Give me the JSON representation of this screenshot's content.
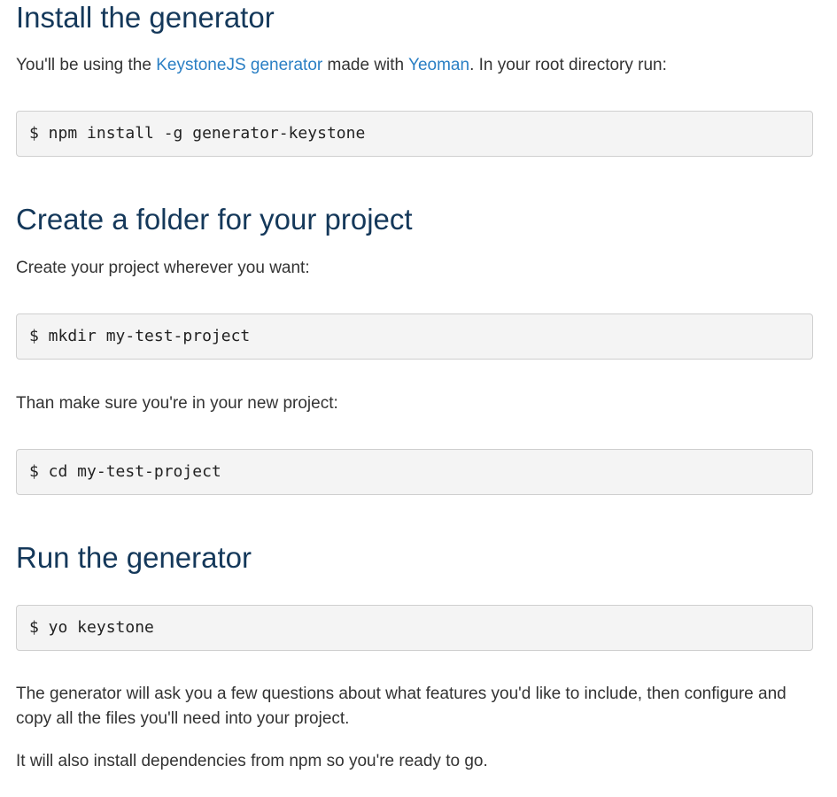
{
  "sections": {
    "install": {
      "heading": "Install the generator",
      "intro_before": "You'll be using the ",
      "link_keystone": "KeystoneJS generator",
      "intro_middle": " made with ",
      "link_yeoman": "Yeoman",
      "intro_after": ". In your root directory run:",
      "command": "$ npm install -g generator-keystone"
    },
    "folder": {
      "heading": "Create a folder for your project",
      "intro": "Create your project wherever you want:",
      "command_mkdir": "$ mkdir my-test-project",
      "followup": "Than make sure you're in your new project:",
      "command_cd": "$ cd my-test-project"
    },
    "run": {
      "heading": "Run the generator",
      "command": "$ yo keystone",
      "paragraph_1": "The generator will ask you a few questions about what features you'd like to include, then configure and copy all the files you'll need into your project.",
      "paragraph_2": "It will also install dependencies from npm so you're ready to go."
    }
  }
}
